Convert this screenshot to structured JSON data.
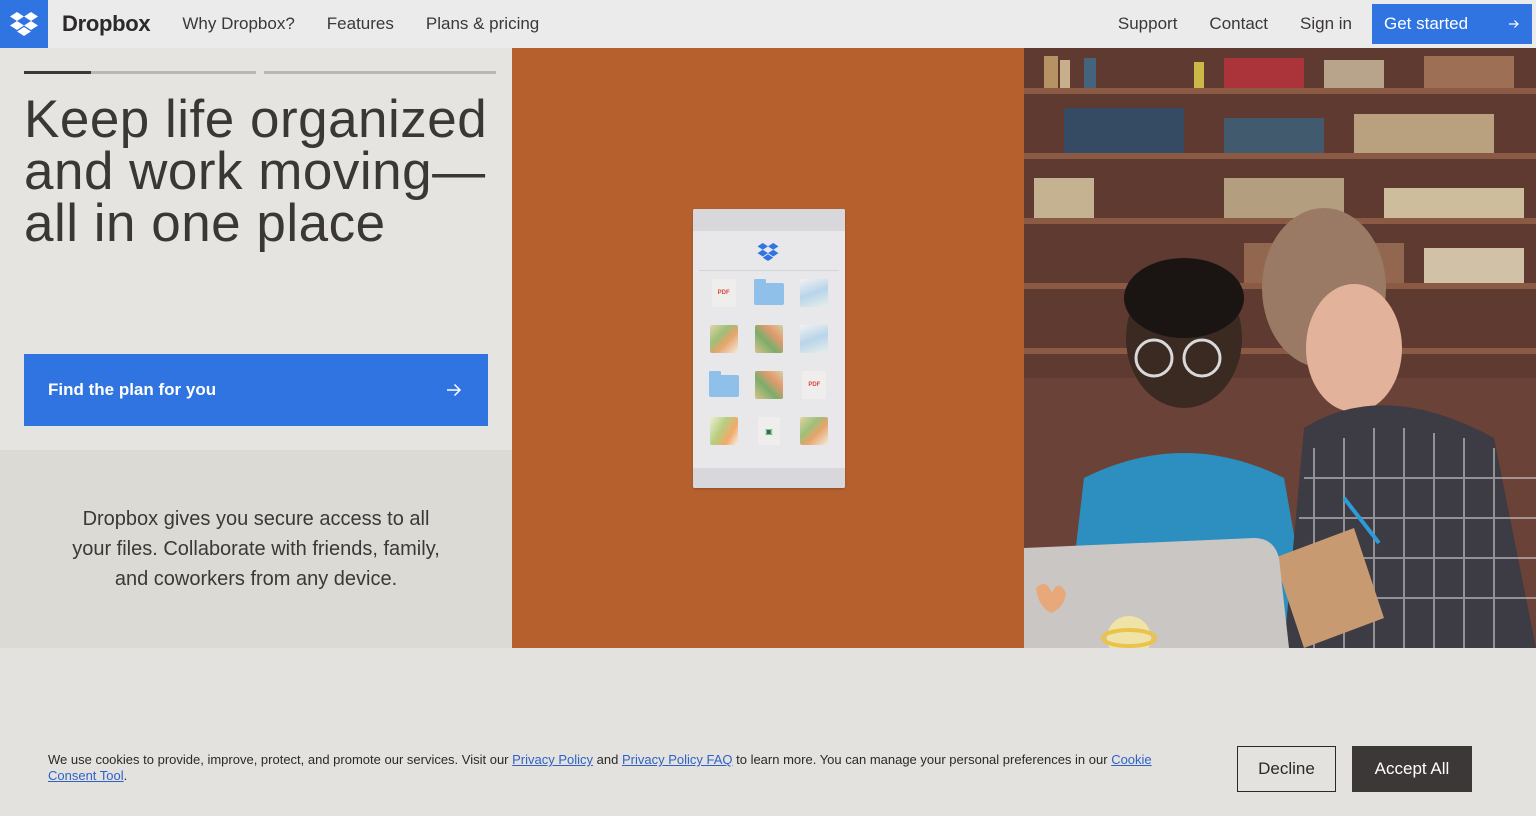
{
  "nav": {
    "brand": "Dropbox",
    "links": [
      "Why Dropbox?",
      "Features",
      "Plans & pricing"
    ],
    "right_links": [
      "Support",
      "Contact",
      "Sign in"
    ],
    "cta": "Get started"
  },
  "hero": {
    "headline": "Keep life organized and work moving—all in one place",
    "cta": "Find the plan for you",
    "description": "Dropbox gives you secure access to all your files. Collaborate with friends, family, and coworkers from any device.",
    "carousel_progress": 0.29
  },
  "phone": {
    "file_labels": [
      "PDF",
      "PDF"
    ]
  },
  "cookie": {
    "text_before": "We use cookies to provide, improve, protect, and promote our services. Visit our ",
    "privacy_link": "Privacy Policy",
    "and": " and ",
    "faq_link": "Privacy Policy FAQ",
    "text_middle": " to learn more. You can manage your personal preferences in our ",
    "consent_link": "Cookie Consent Tool",
    "text_end": ".",
    "decline": "Decline",
    "accept": "Accept All"
  },
  "colors": {
    "accent": "#2f74e1",
    "mid_panel": "#b6602e",
    "dark": "#3b3837"
  }
}
